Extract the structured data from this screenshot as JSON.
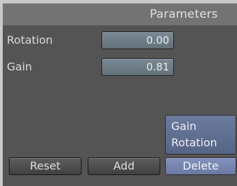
{
  "header": {
    "title": "Parameters"
  },
  "params": [
    {
      "label": "Rotation",
      "value": "0.00"
    },
    {
      "label": "Gain",
      "value": "0.81"
    }
  ],
  "list": {
    "items": [
      "Gain",
      "Rotation"
    ]
  },
  "buttons": {
    "reset": "Reset",
    "add": "Add",
    "delete": "Delete"
  },
  "colors": {
    "panel_bg": "#545454",
    "header_bg": "#737373",
    "field_bg": "#6f7d89",
    "list_bg": "#64729a",
    "delete_bg": "#7684af"
  }
}
